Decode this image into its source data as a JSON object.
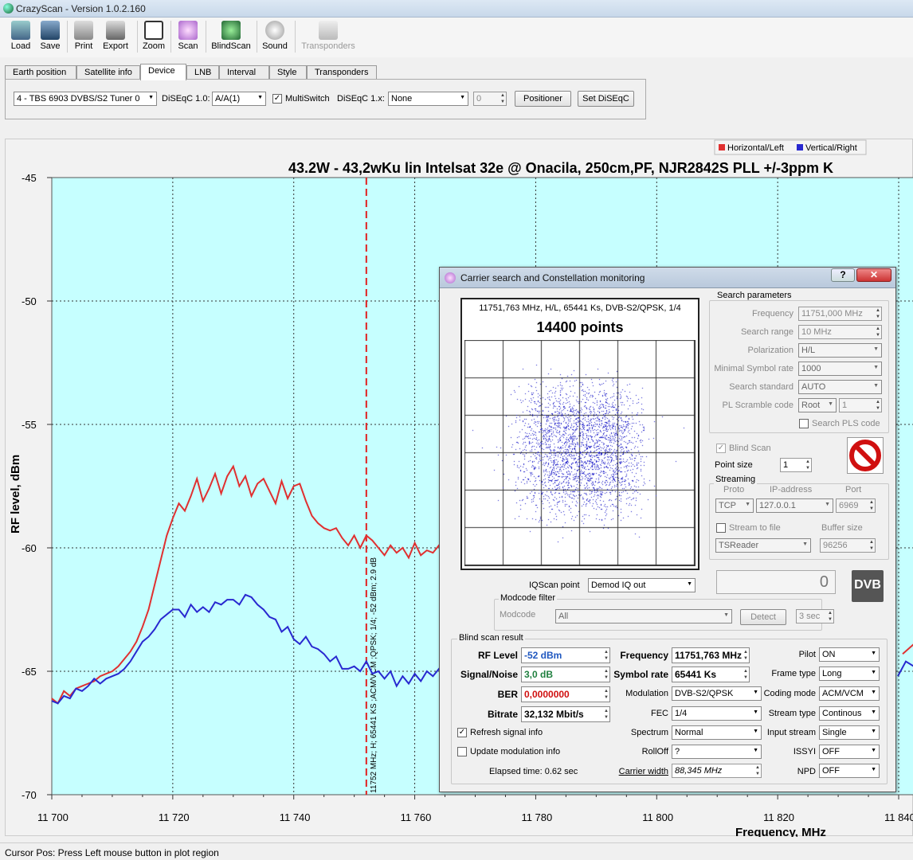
{
  "app": {
    "title": "CrazyScan - Version 1.0.2.160"
  },
  "toolbar": {
    "load": "Load",
    "save": "Save",
    "print": "Print",
    "export": "Export",
    "zoom": "Zoom",
    "scan": "Scan",
    "blindscan": "BlindScan",
    "sound": "Sound",
    "transponders": "Transponders"
  },
  "tabs": [
    "Earth position",
    "Satellite info",
    "Device",
    "LNB",
    "Interval",
    "Style",
    "Transponders"
  ],
  "device": {
    "tuner": "4 - TBS 6903 DVBS/S2 Tuner 0",
    "diseqc10_label": "DiSEqC 1.0:",
    "diseqc10_value": "A/A(1)",
    "multiswitch": "MultiSwitch",
    "diseqc1x_label": "DiSEqC 1.x:",
    "diseqc1x_value": "None",
    "diseqc1x_num": "0",
    "positioner": "Positioner",
    "set_diseqc": "Set DiSEqC"
  },
  "plot": {
    "title": "43.2W - 43,2wKu lin Intelsat 32e @ Onacila, 250cm,PF, NJR2842S PLL +/-3ppm K",
    "xlabel": "Frequency, MHz",
    "ylabel": "RF level, dBm",
    "legend": {
      "h": "Horizontal/Left",
      "v": "Vertical/Right",
      "h_color": "#e03030",
      "v_color": "#2828d0"
    },
    "cursor_label": "11752 MHz; H; 65441 KS ;ACM/VCM ;QPSK; 1/4; -52 dBm; 2.9 dB"
  },
  "chart_data": {
    "type": "line",
    "xlim": [
      11700,
      11850
    ],
    "ylim": [
      -70,
      -45
    ],
    "xticks": [
      "11 700",
      "11 720",
      "11 740",
      "11 760",
      "11 780",
      "11 800",
      "11 820",
      "11 840"
    ],
    "yticks": [
      "-45",
      "-50",
      "-55",
      "-60",
      "-65",
      "-70"
    ],
    "cursor_x": 11752,
    "series": [
      {
        "name": "Horizontal/Left",
        "color": "#e03030",
        "points": [
          [
            11700,
            -66.1
          ],
          [
            11701,
            -66.3
          ],
          [
            11702,
            -65.8
          ],
          [
            11703,
            -66.0
          ],
          [
            11704,
            -65.7
          ],
          [
            11705,
            -65.6
          ],
          [
            11706,
            -65.5
          ],
          [
            11707,
            -65.4
          ],
          [
            11708,
            -65.2
          ],
          [
            11709,
            -65.1
          ],
          [
            11710,
            -65.0
          ],
          [
            11711,
            -64.8
          ],
          [
            11712,
            -64.5
          ],
          [
            11713,
            -64.2
          ],
          [
            11714,
            -63.8
          ],
          [
            11715,
            -63.2
          ],
          [
            11716,
            -62.5
          ],
          [
            11717,
            -61.5
          ],
          [
            11718,
            -60.5
          ],
          [
            11719,
            -59.5
          ],
          [
            11720,
            -58.8
          ],
          [
            11721,
            -58.2
          ],
          [
            11722,
            -58.5
          ],
          [
            11723,
            -57.9
          ],
          [
            11724,
            -57.2
          ],
          [
            11725,
            -58.1
          ],
          [
            11726,
            -57.6
          ],
          [
            11727,
            -57.0
          ],
          [
            11728,
            -57.8
          ],
          [
            11729,
            -57.1
          ],
          [
            11730,
            -56.7
          ],
          [
            11731,
            -57.5
          ],
          [
            11732,
            -57.1
          ],
          [
            11733,
            -57.9
          ],
          [
            11734,
            -57.4
          ],
          [
            11735,
            -57.2
          ],
          [
            11736,
            -57.7
          ],
          [
            11737,
            -58.2
          ],
          [
            11738,
            -57.3
          ],
          [
            11739,
            -58.0
          ],
          [
            11740,
            -57.5
          ],
          [
            11741,
            -57.4
          ],
          [
            11742,
            -58.1
          ],
          [
            11743,
            -58.7
          ],
          [
            11744,
            -59.0
          ],
          [
            11745,
            -59.2
          ],
          [
            11746,
            -59.3
          ],
          [
            11747,
            -59.2
          ],
          [
            11748,
            -59.6
          ],
          [
            11749,
            -59.9
          ],
          [
            11750,
            -59.5
          ],
          [
            11751,
            -60.0
          ],
          [
            11752,
            -59.5
          ],
          [
            11753,
            -59.7
          ],
          [
            11754,
            -60.0
          ],
          [
            11755,
            -60.3
          ],
          [
            11756,
            -59.9
          ],
          [
            11757,
            -60.2
          ],
          [
            11758,
            -60.0
          ],
          [
            11759,
            -60.4
          ],
          [
            11760,
            -59.8
          ],
          [
            11761,
            -60.3
          ],
          [
            11762,
            -60.1
          ],
          [
            11763,
            -60.2
          ],
          [
            11764,
            -59.9
          ],
          [
            11765,
            -60.4
          ],
          [
            11766,
            -60.2
          ]
        ]
      },
      {
        "name": "Vertical/Right",
        "color": "#2828d0",
        "points": [
          [
            11700,
            -66.2
          ],
          [
            11701,
            -66.3
          ],
          [
            11702,
            -66.0
          ],
          [
            11703,
            -66.1
          ],
          [
            11704,
            -65.7
          ],
          [
            11705,
            -65.8
          ],
          [
            11706,
            -65.6
          ],
          [
            11707,
            -65.3
          ],
          [
            11708,
            -65.5
          ],
          [
            11709,
            -65.3
          ],
          [
            11710,
            -65.2
          ],
          [
            11711,
            -65.1
          ],
          [
            11712,
            -64.9
          ],
          [
            11713,
            -64.6
          ],
          [
            11714,
            -64.2
          ],
          [
            11715,
            -63.8
          ],
          [
            11716,
            -63.6
          ],
          [
            11717,
            -63.3
          ],
          [
            11718,
            -62.9
          ],
          [
            11719,
            -62.7
          ],
          [
            11720,
            -62.5
          ],
          [
            11721,
            -62.5
          ],
          [
            11722,
            -62.8
          ],
          [
            11723,
            -62.3
          ],
          [
            11724,
            -62.6
          ],
          [
            11725,
            -62.4
          ],
          [
            11726,
            -62.6
          ],
          [
            11727,
            -62.2
          ],
          [
            11728,
            -62.3
          ],
          [
            11729,
            -62.1
          ],
          [
            11730,
            -62.1
          ],
          [
            11731,
            -62.3
          ],
          [
            11732,
            -61.9
          ],
          [
            11733,
            -62.0
          ],
          [
            11734,
            -62.3
          ],
          [
            11735,
            -62.5
          ],
          [
            11736,
            -62.8
          ],
          [
            11737,
            -62.9
          ],
          [
            11738,
            -63.4
          ],
          [
            11739,
            -63.2
          ],
          [
            11740,
            -63.7
          ],
          [
            11741,
            -63.9
          ],
          [
            11742,
            -63.6
          ],
          [
            11743,
            -64.0
          ],
          [
            11744,
            -64.1
          ],
          [
            11745,
            -64.3
          ],
          [
            11746,
            -64.6
          ],
          [
            11747,
            -64.4
          ],
          [
            11748,
            -64.9
          ],
          [
            11749,
            -64.9
          ],
          [
            11750,
            -64.8
          ],
          [
            11751,
            -65.0
          ],
          [
            11752,
            -64.6
          ],
          [
            11753,
            -65.1
          ],
          [
            11754,
            -65.0
          ],
          [
            11755,
            -65.3
          ],
          [
            11756,
            -65.0
          ],
          [
            11757,
            -65.6
          ],
          [
            11758,
            -65.2
          ],
          [
            11759,
            -65.5
          ],
          [
            11760,
            -65.1
          ],
          [
            11761,
            -65.4
          ],
          [
            11762,
            -65.0
          ],
          [
            11763,
            -65.2
          ],
          [
            11764,
            -64.9
          ],
          [
            11765,
            -65.1
          ],
          [
            11766,
            -64.8
          ]
        ]
      }
    ]
  },
  "status": {
    "cursor": "Cursor Pos: Press Left mouse button in plot region"
  },
  "dialog": {
    "title": "Carrier search and Constellation monitoring",
    "const_info": "11751,763 MHz, H/L, 65441 Ks, DVB-S2/QPSK, 1/4",
    "const_points": "14400 points",
    "search": {
      "title": "Search parameters",
      "frequency_l": "Frequency",
      "frequency": "11751,000 MHz",
      "range_l": "Search range",
      "range": "10 MHz",
      "pol_l": "Polarization",
      "pol": "H/L",
      "minsr_l": "Minimal Symbol rate",
      "minsr": "1000",
      "std_l": "Search standard",
      "std": "AUTO",
      "pls_l": "PL Scramble code",
      "pls_mode": "Root",
      "pls_val": "1",
      "search_pls": "Search PLS code"
    },
    "blind_scan": "Blind Scan",
    "point_size_l": "Point size",
    "point_size": "1",
    "streaming": {
      "title": "Streaming",
      "proto_l": "Proto",
      "ip_l": "IP-address",
      "port_l": "Port",
      "proto": "TCP",
      "ip": "127.0.0.1",
      "port": "6969",
      "stream_file": "Stream to file",
      "buffer_l": "Buffer size",
      "reader": "TSReader",
      "buffer": "96256"
    },
    "iqscan_l": "IQScan point",
    "iqscan": "Demod IQ out",
    "counter": "0",
    "modcode": {
      "title": "Modcode filter",
      "l": "Modcode",
      "value": "All",
      "detect": "Detect",
      "secs": "3 sec"
    },
    "result": {
      "title": "Blind scan result",
      "rf_l": "RF Level",
      "rf": "-52 dBm",
      "sn_l": "Signal/Noise",
      "sn": "3,0 dB",
      "ber_l": "BER",
      "ber": "0,0000000",
      "br_l": "Bitrate",
      "br": "32,132 Mbit/s",
      "freq_l": "Frequency",
      "freq": "11751,763 MHz",
      "sr_l": "Symbol rate",
      "sr": "65441 Ks",
      "mod_l": "Modulation",
      "mod": "DVB-S2/QPSK",
      "fec_l": "FEC",
      "fec": "1/4",
      "spec_l": "Spectrum",
      "spec": "Normal",
      "roll_l": "RollOff",
      "roll": "?",
      "cw_l": "Carrier width",
      "cw": "88,345 MHz",
      "pilot_l": "Pilot",
      "pilot": "ON",
      "frame_l": "Frame type",
      "frame": "Long",
      "coding_l": "Coding mode",
      "coding": "ACM/VCM",
      "stype_l": "Stream type",
      "stype": "Continous",
      "istream_l": "Input stream",
      "istream": "Single",
      "issyi_l": "ISSYI",
      "issyi": "OFF",
      "npd_l": "NPD",
      "npd": "OFF",
      "refresh": "Refresh signal info",
      "update": "Update modulation info",
      "elapsed": "Elapsed time: 0.62 sec"
    }
  }
}
